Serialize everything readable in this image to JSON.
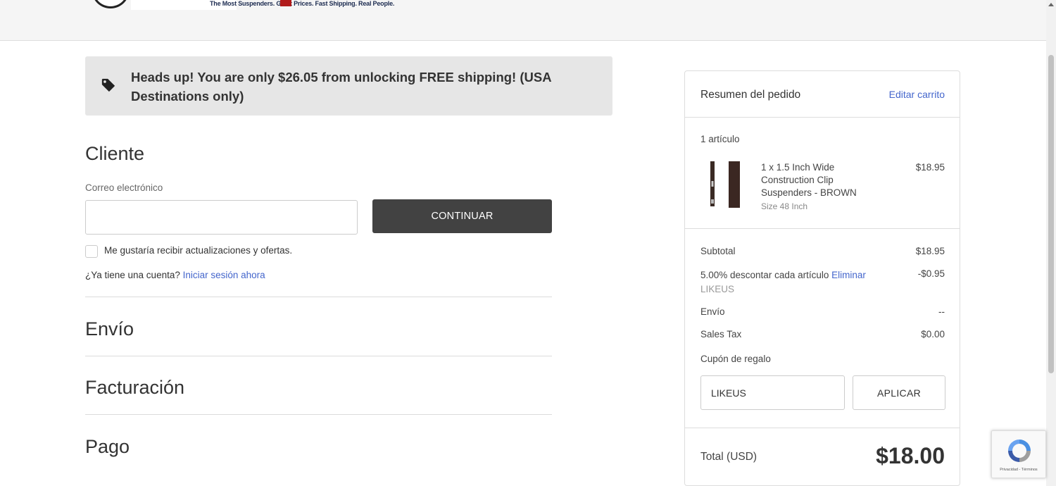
{
  "header": {
    "tagline": "The Most Suspenders. Great Prices. Fast Shipping. Real People."
  },
  "banner": {
    "icon": "tag-icon",
    "text": "Heads up! You are only $26.05 from unlocking FREE shipping! (USA Destinations only)"
  },
  "customer": {
    "title": "Cliente",
    "email_label": "Correo electrónico",
    "email_value": "",
    "continue_label": "CONTINUAR",
    "newsletter_label": "Me gustaría recibir actualizaciones y ofertas.",
    "newsletter_checked": false,
    "account_prompt": "¿Ya tiene una cuenta?",
    "signin_link": "Iniciar sesión ahora"
  },
  "sections": {
    "shipping": "Envío",
    "billing": "Facturación",
    "payment": "Pago"
  },
  "summary": {
    "title": "Resumen del pedido",
    "edit_link": "Editar carrito",
    "items_count": "1 artículo",
    "item": {
      "name": "1 x 1.5 Inch Wide Construction Clip Suspenders - BROWN",
      "size": "Size 48 Inch",
      "price": "$18.95"
    },
    "subtotal_label": "Subtotal",
    "subtotal_value": "$18.95",
    "discount_label": "5.00% descontar cada artículo",
    "discount_remove": "Eliminar",
    "discount_code": "LIKEUS",
    "discount_value": "-$0.95",
    "shipping_label": "Envío",
    "shipping_value": "--",
    "tax_label": "Sales Tax",
    "tax_value": "$0.00",
    "coupon_label": "Cupón de regalo",
    "coupon_value": "LIKEUS",
    "apply_label": "APLICAR",
    "total_label": "Total (USD)",
    "total_value": "$18.00"
  },
  "recaptcha": {
    "text": "Privacidad - Términos"
  },
  "colors": {
    "link": "#4466cc",
    "button_dark": "#424242",
    "banner_bg": "#e6e6e6"
  }
}
